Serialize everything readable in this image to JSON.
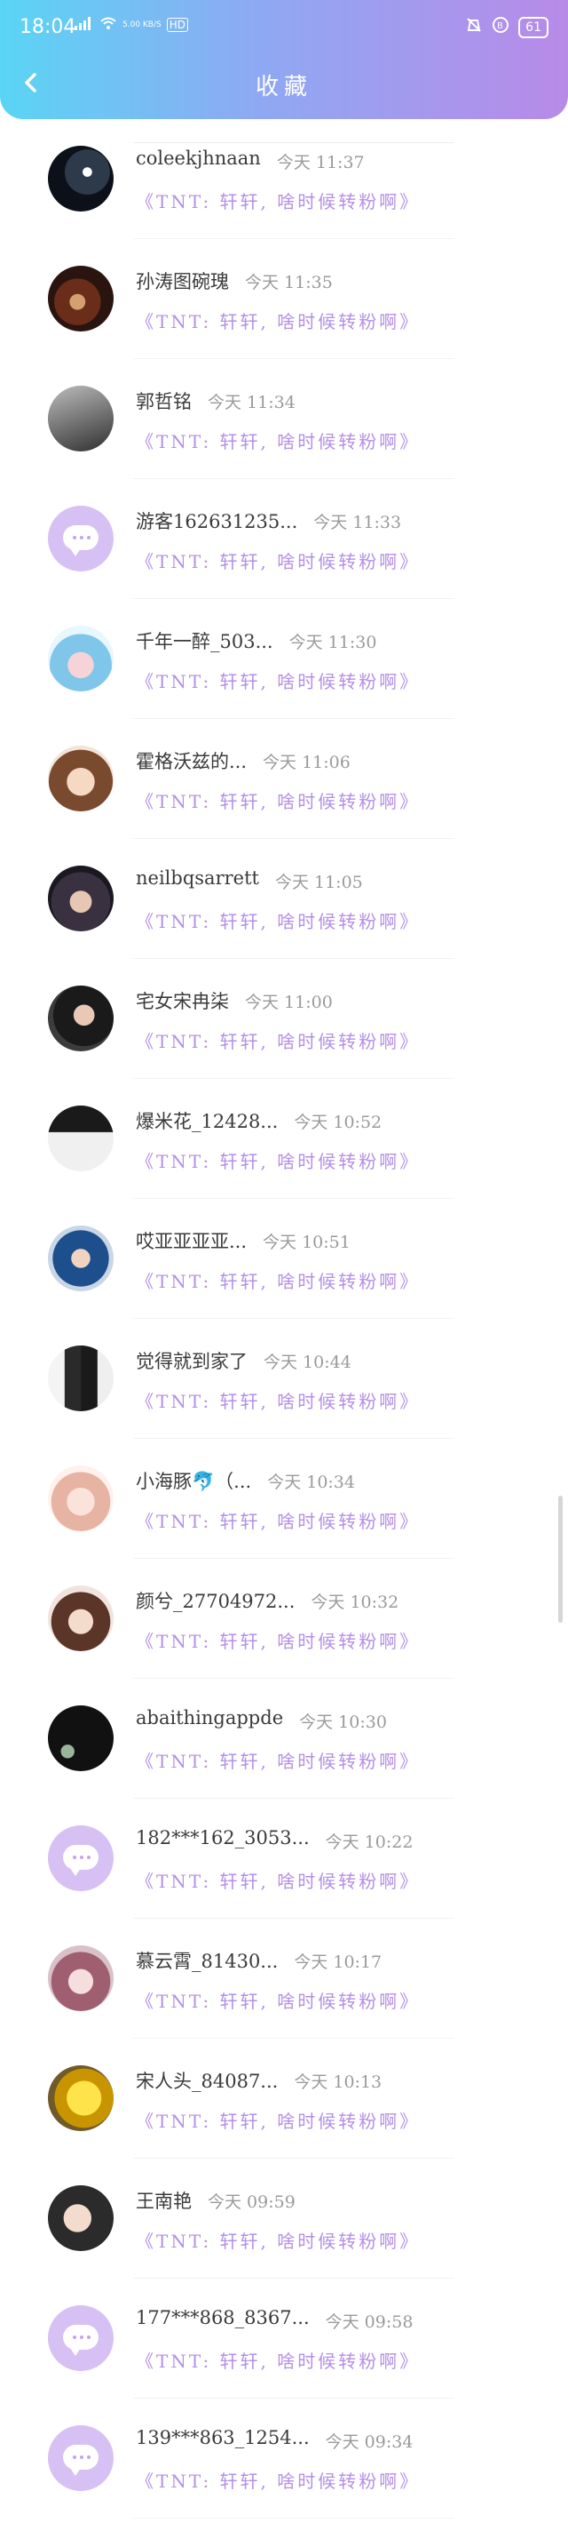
{
  "status_bar": {
    "time": "18:04",
    "network_speed": "5.00\nKB/S",
    "hd_label": "HD",
    "battery": "61"
  },
  "header": {
    "title": "收藏"
  },
  "colors": {
    "gradient_start": "#5ad5f4",
    "gradient_end": "#b88ae8",
    "accent": "#b48fe6"
  },
  "list": [
    {
      "name": "coleekjhnaan",
      "time": "今天 11:37",
      "preview": "《TNT: 轩轩, 啥时候转粉啊》",
      "avatar": "photo-dark"
    },
    {
      "name": "孙涛图碗瑰",
      "time": "今天 11:35",
      "preview": "《TNT: 轩轩, 啥时候转粉啊》",
      "avatar": "photo-warm"
    },
    {
      "name": "郭哲铭",
      "time": "今天 11:34",
      "preview": "《TNT: 轩轩, 啥时候转粉啊》",
      "avatar": "photo-gray"
    },
    {
      "name": "游客162631235...",
      "time": "今天 11:33",
      "preview": "《TNT: 轩轩, 啥时候转粉啊》",
      "avatar": "default"
    },
    {
      "name": "千年一醉_503...",
      "time": "今天 11:30",
      "preview": "《TNT: 轩轩, 啥时候转粉啊》",
      "avatar": "photo-cartoon"
    },
    {
      "name": "霍格沃兹的...",
      "time": "今天 11:06",
      "preview": "《TNT: 轩轩, 啥时候转粉啊》",
      "avatar": "photo-girl"
    },
    {
      "name": "neilbqsarrett",
      "time": "今天 11:05",
      "preview": "《TNT: 轩轩, 啥时候转粉啊》",
      "avatar": "photo-anime"
    },
    {
      "name": "宅女宋冉柒",
      "time": "今天 11:00",
      "preview": "《TNT: 轩轩, 啥时候转粉啊》",
      "avatar": "photo-portrait"
    },
    {
      "name": "爆米花_12428...",
      "time": "今天 10:52",
      "preview": "《TNT: 轩轩, 啥时候转粉啊》",
      "avatar": "photo-group"
    },
    {
      "name": "哎亚亚亚亚...",
      "time": "今天 10:51",
      "preview": "《TNT: 轩轩, 啥时候转粉啊》",
      "avatar": "photo-blue"
    },
    {
      "name": "觉得就到家了",
      "time": "今天 10:44",
      "preview": "《TNT: 轩轩, 啥时候转粉啊》",
      "avatar": "photo-pair"
    },
    {
      "name": "小海豚🐬（...",
      "time": "今天 10:34",
      "preview": "《TNT: 轩轩, 啥时候转粉啊》",
      "avatar": "photo-pink"
    },
    {
      "name": "颜兮_27704972...",
      "time": "今天 10:32",
      "preview": "《TNT: 轩轩, 啥时候转粉啊》",
      "avatar": "photo-brown"
    },
    {
      "name": "abaithingappde",
      "time": "今天 10:30",
      "preview": "《TNT: 轩轩, 啥时候转粉啊》",
      "avatar": "photo-black"
    },
    {
      "name": "182***162_3053...",
      "time": "今天 10:22",
      "preview": "《TNT: 轩轩, 啥时候转粉啊》",
      "avatar": "default"
    },
    {
      "name": "慕云霄_81430...",
      "time": "今天 10:17",
      "preview": "《TNT: 轩轩, 啥时候转粉啊》",
      "avatar": "photo-rose"
    },
    {
      "name": "宋人头_84087...",
      "time": "今天 10:13",
      "preview": "《TNT: 轩轩, 啥时候转粉啊》",
      "avatar": "photo-yellow"
    },
    {
      "name": "王南艳",
      "time": "今天 09:59",
      "preview": "《TNT: 轩轩, 啥时候转粉啊》",
      "avatar": "photo-face"
    },
    {
      "name": "177***868_8367...",
      "time": "今天 09:58",
      "preview": "《TNT: 轩轩, 啥时候转粉啊》",
      "avatar": "default"
    },
    {
      "name": "139***863_1254...",
      "time": "今天 09:34",
      "preview": "《TNT: 轩轩, 啥时候转粉啊》",
      "avatar": "default"
    }
  ],
  "scroll": {
    "position": 0.62,
    "visible_fraction": 0.05
  }
}
